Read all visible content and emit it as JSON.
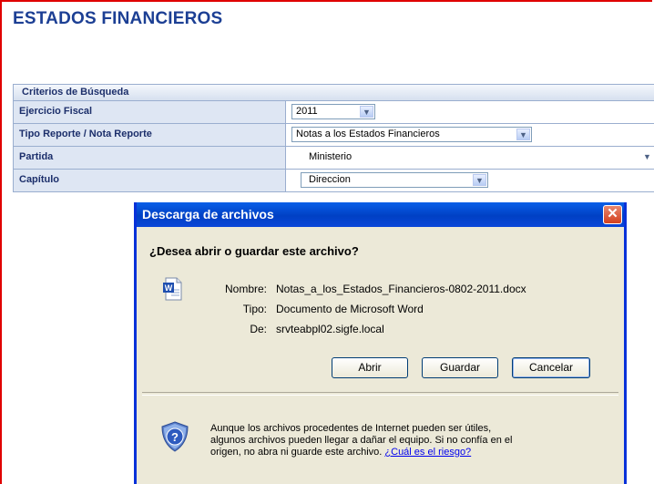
{
  "page": {
    "title": "ESTADOS FINANCIEROS"
  },
  "criteria": {
    "header": "Criterios de Búsqueda",
    "rows": [
      {
        "label": "Ejercicio Fiscal",
        "value": "2011"
      },
      {
        "label": "Tipo Reporte / Nota Reporte",
        "value": "Notas a los Estados Financieros"
      },
      {
        "label": "Partida",
        "value": "Ministerio"
      },
      {
        "label": "Capítulo",
        "value": "Direccion"
      }
    ]
  },
  "dialog": {
    "title": "Descarga de archivos",
    "close_label": "✕",
    "question": "¿Desea abrir o guardar este archivo?",
    "file": {
      "name_label": "Nombre:",
      "name_value": "Notas_a_los_Estados_Financieros-0802-2011.docx",
      "type_label": "Tipo:",
      "type_value": "Documento de Microsoft Word",
      "from_label": "De:",
      "from_value": "srvteabpl02.sigfe.local"
    },
    "buttons": {
      "open": "Abrir",
      "save": "Guardar",
      "cancel": "Cancelar"
    },
    "warning_text": "Aunque los archivos procedentes de Internet pueden ser útiles, algunos archivos pueden llegar a dañar el equipo. Si no confía en el origen, no abra ni guarde este archivo.",
    "risk_link": "¿Cuál es el riesgo?",
    "file_icon": "word-document-icon",
    "shield_icon": "security-shield-icon"
  },
  "colors": {
    "title": "#1c3f94",
    "titlebar": "#0a46d8",
    "frame": "#e00000"
  }
}
